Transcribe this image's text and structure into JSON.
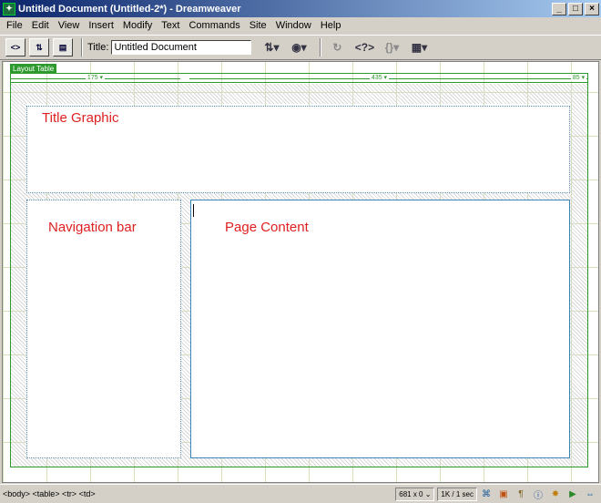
{
  "window": {
    "title": "Untitled Document (Untitled-2*) - Dreamweaver",
    "minimize": "_",
    "maximize": "□",
    "close": "×"
  },
  "menu": [
    "File",
    "Edit",
    "View",
    "Insert",
    "Modify",
    "Text",
    "Commands",
    "Site",
    "Window",
    "Help"
  ],
  "toolbar": {
    "title_label": "Title:",
    "title_value": "Untitled Document",
    "code_view_icon": "code-view-icon",
    "split_view_icon": "code-design-view-icon",
    "design_view_icon": "design-view-icon",
    "file_management_icon": "file-management-icon",
    "preview_icon": "preview-browser-icon",
    "refresh_icon": "refresh-icon",
    "reference_icon": "reference-icon",
    "code_nav_icon": "code-navigation-icon",
    "view_options_icon": "view-options-icon"
  },
  "layout": {
    "tab_label": "Layout Table",
    "columns": [
      "175 ▾",
      "435 ▾",
      "85 ▾"
    ],
    "cells": {
      "title": "Title Graphic",
      "nav": "Navigation bar",
      "content": "Page Content"
    }
  },
  "status": {
    "tag_selector": "<body> <table> <tr> <td>",
    "window_size": "681 x 0 ⌄",
    "download": "1K / 1 sec"
  },
  "colors": {
    "title_gradient_start": "#0a246a",
    "title_gradient_end": "#a6caf0",
    "layout_green": "#2e9a2e",
    "cell_label_red": "#e02020",
    "cell_border": "#3a86b8"
  }
}
